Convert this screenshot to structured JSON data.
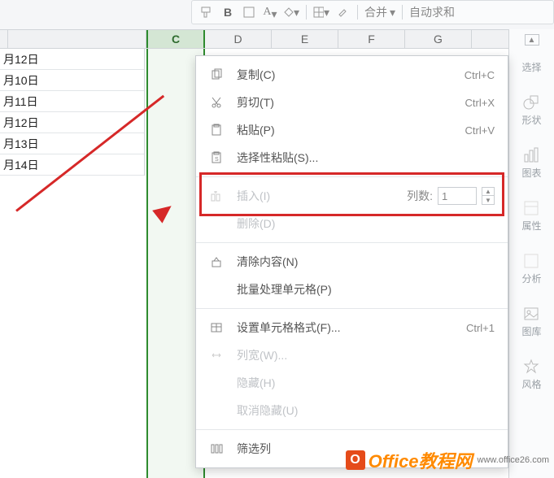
{
  "toolbar": {
    "merge": "合并",
    "autosum": "自动求和"
  },
  "columns": {
    "c": "C",
    "d": "D",
    "e": "E",
    "f": "F",
    "g": "G"
  },
  "data_cells": [
    "月12日",
    "月10日",
    "月11日",
    "月12日",
    "月13日",
    "月14日"
  ],
  "side_panel": {
    "select": "选择",
    "shapes": "形状",
    "chart": "图表",
    "props": "属性",
    "analyze": "分析",
    "gallery": "图库",
    "style": "风格"
  },
  "context_menu": {
    "copy": "复制(C)",
    "copy_sc": "Ctrl+C",
    "cut": "剪切(T)",
    "cut_sc": "Ctrl+X",
    "paste": "粘贴(P)",
    "paste_sc": "Ctrl+V",
    "paste_special": "选择性粘贴(S)...",
    "insert": "插入(I)",
    "insert_cols_label": "列数:",
    "insert_cols_value": "1",
    "delete": "删除(D)",
    "clear": "清除内容(N)",
    "batch": "批量处理单元格(P)",
    "format": "设置单元格格式(F)...",
    "format_sc": "Ctrl+1",
    "col_width": "列宽(W)...",
    "hide": "隐藏(H)",
    "unhide": "取消隐藏(U)",
    "filter": "筛选列"
  },
  "watermark_text": "Office教程网",
  "watermark_domain": "www.office26.com"
}
